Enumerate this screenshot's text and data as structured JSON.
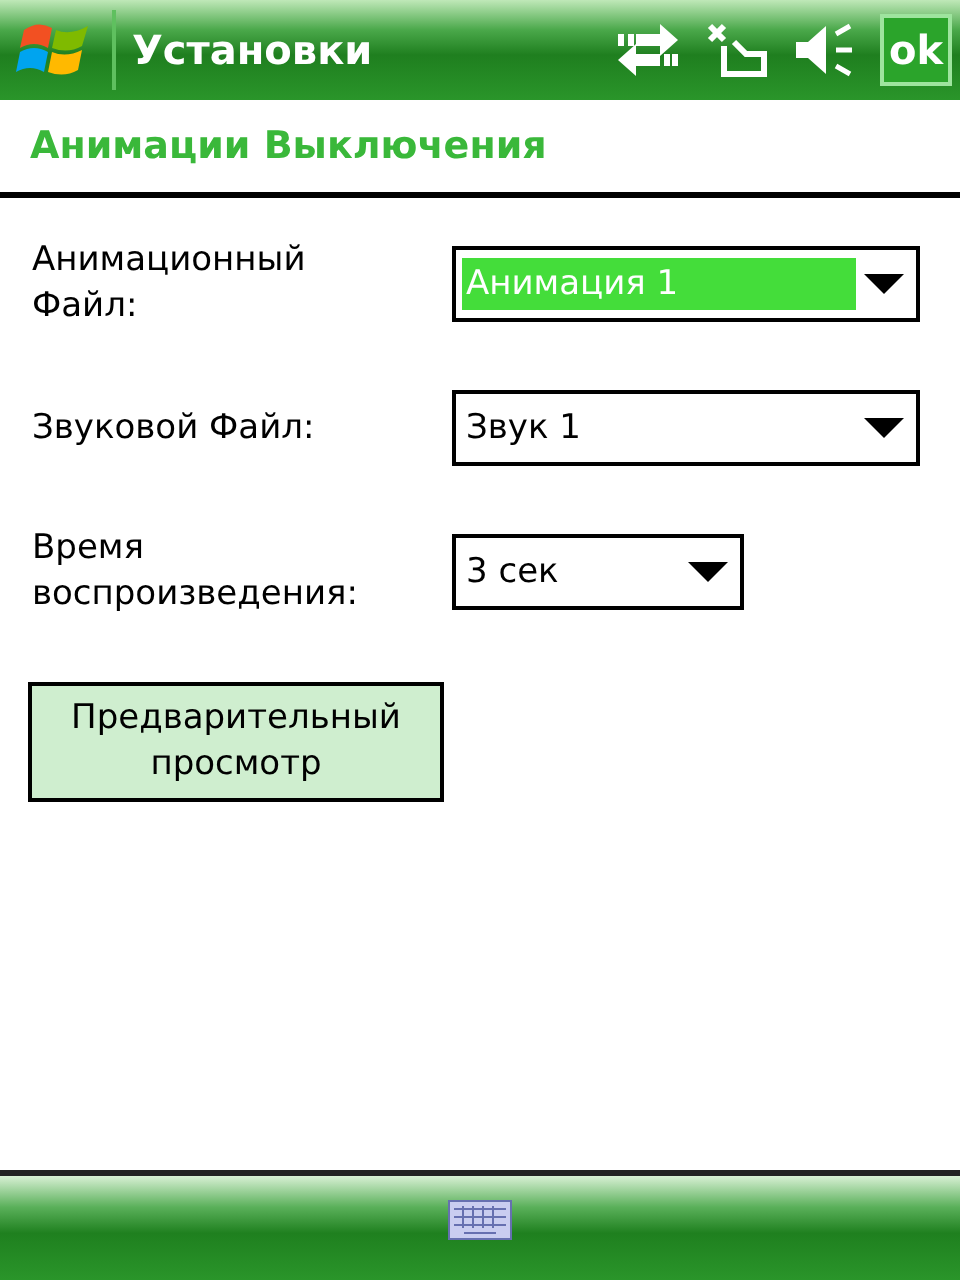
{
  "title_bar": {
    "title": "Установки",
    "ok_button": "ok"
  },
  "heading": "Анимации Выключения",
  "fields": [
    {
      "label": "Анимационный Файл:",
      "value": "Анимация 1",
      "focused": true,
      "kind": "wide"
    },
    {
      "label": "Звуковой Файл:",
      "value": "Звук 1",
      "focused": false,
      "kind": "wide"
    },
    {
      "label": "Время воспроизведения:",
      "value": "3 сек",
      "focused": false,
      "kind": "narrow"
    }
  ],
  "preview_button": "Предварительный просмотр"
}
